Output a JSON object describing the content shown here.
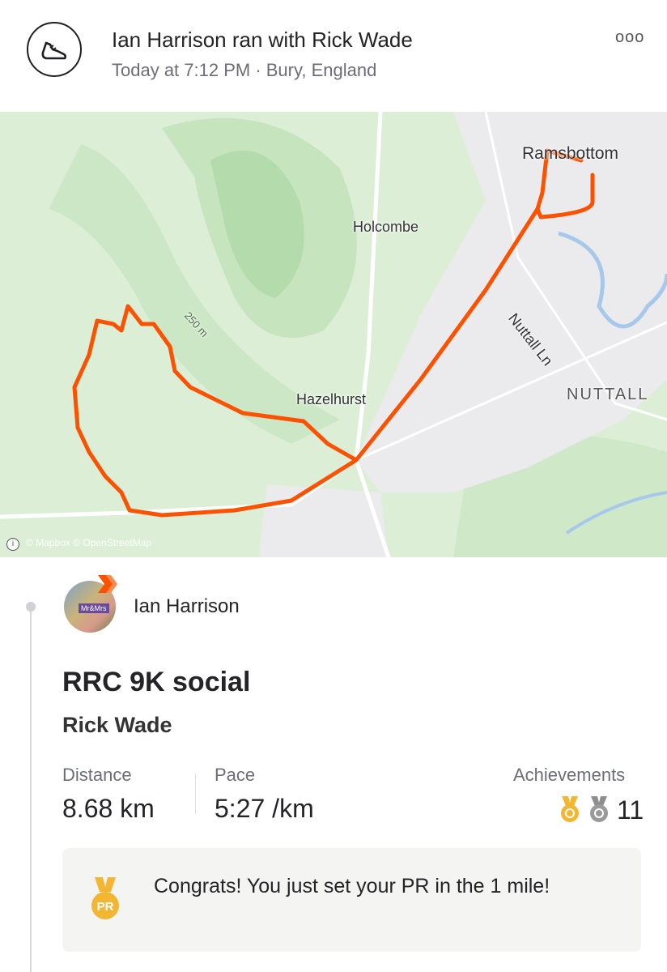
{
  "header": {
    "title": "Ian Harrison ran with Rick Wade",
    "subtitle": "Today at 7:12 PM · Bury, England",
    "more_label": "ooo",
    "icon": "running-shoe-icon"
  },
  "map": {
    "labels": {
      "ramsbottom": "Ramsbottom",
      "holcombe": "Holcombe",
      "nuttall_ln": "Nuttall Ln",
      "nuttall": "NUTTALL",
      "hazelhurst": "Hazelhurst",
      "contour": "250 m"
    },
    "attribution": "© Mapbox © OpenStreetMap",
    "route_color": "#fc5200"
  },
  "activity": {
    "athlete": "Ian Harrison",
    "title": "RRC 9K social",
    "partner": "Rick Wade",
    "stats": {
      "distance_label": "Distance",
      "distance_value": "8.68 km",
      "pace_label": "Pace",
      "pace_value": "5:27 /km",
      "achievements_label": "Achievements",
      "achievements_count": "11"
    },
    "pr": {
      "badge": "PR",
      "text": "Congrats! You just set your PR in the 1 mile!"
    }
  },
  "colors": {
    "accent": "#fc5200",
    "gold_medal": "#f2b632",
    "silver_medal": "#9a9a9a"
  }
}
